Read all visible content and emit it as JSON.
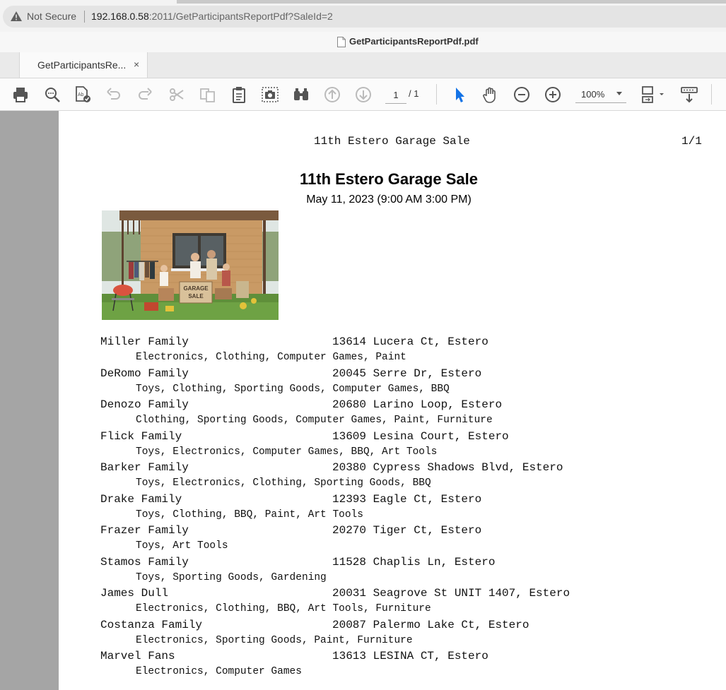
{
  "browser": {
    "security_label": "Not Secure",
    "url_host": "192.168.0.58",
    "url_rest": ":2011/GetParticipantsReportPdf?SaleId=2"
  },
  "pdf_viewer": {
    "file_name": "GetParticipantsReportPdf.pdf",
    "tab_label": "GetParticipantsRe...",
    "tab_close": "×",
    "current_page": "1",
    "page_total": "/ 1",
    "zoom": "100%"
  },
  "toolbar_icons": [
    "print-icon",
    "search-icon",
    "spell-check-icon",
    "undo-icon",
    "redo-icon",
    "cut-icon",
    "copy-icon",
    "paste-icon",
    "snapshot-icon",
    "binoculars-icon",
    "previous-page-icon",
    "next-page-icon",
    "select-cursor-icon",
    "hand-tool-icon",
    "zoom-out-icon",
    "zoom-in-icon",
    "page-fit-icon",
    "read-mode-icon"
  ],
  "document": {
    "running_header": "11th Estero Garage Sale",
    "page_indicator": "1/1",
    "title": "11th Estero Garage Sale",
    "date": "May 11, 2023 (9:00 AM 3:00 PM)",
    "photo_sign_text": "GARAGE SALE",
    "participants": [
      {
        "name": "Miller Family",
        "address": "13614 Lucera Ct, Estero",
        "categories": "Electronics, Clothing, Computer Games, Paint"
      },
      {
        "name": "DeRomo Family",
        "address": "20045 Serre Dr, Estero",
        "categories": "Toys, Clothing, Sporting Goods, Computer Games, BBQ"
      },
      {
        "name": "Denozo Family",
        "address": "20680 Larino Loop, Estero",
        "categories": "Clothing, Sporting Goods, Computer Games, Paint, Furniture"
      },
      {
        "name": "Flick Family",
        "address": "13609 Lesina Court, Estero",
        "categories": "Toys, Electronics, Computer Games, BBQ, Art Tools"
      },
      {
        "name": "Barker Family",
        "address": "20380 Cypress Shadows Blvd, Estero",
        "categories": "Toys, Electronics, Clothing, Sporting Goods, BBQ"
      },
      {
        "name": "Drake Family",
        "address": "12393 Eagle Ct, Estero",
        "categories": "Toys, Clothing, BBQ, Paint, Art Tools"
      },
      {
        "name": "Frazer Family",
        "address": "20270 Tiger Ct, Estero",
        "categories": "Toys, Art Tools"
      },
      {
        "name": "Stamos Family",
        "address": "11528 Chaplis Ln, Estero",
        "categories": "Toys, Sporting Goods, Gardening"
      },
      {
        "name": "James Dull",
        "address": "20031 Seagrove St UNIT 1407, Estero",
        "categories": "Electronics, Clothing, BBQ, Art Tools, Furniture"
      },
      {
        "name": "Costanza Family",
        "address": "20087 Palermo Lake Ct, Estero",
        "categories": "Electronics, Sporting Goods, Paint, Furniture"
      },
      {
        "name": "Marvel Fans",
        "address": "13613 LESINA CT, Estero",
        "categories": "Electronics, Computer Games"
      }
    ]
  }
}
